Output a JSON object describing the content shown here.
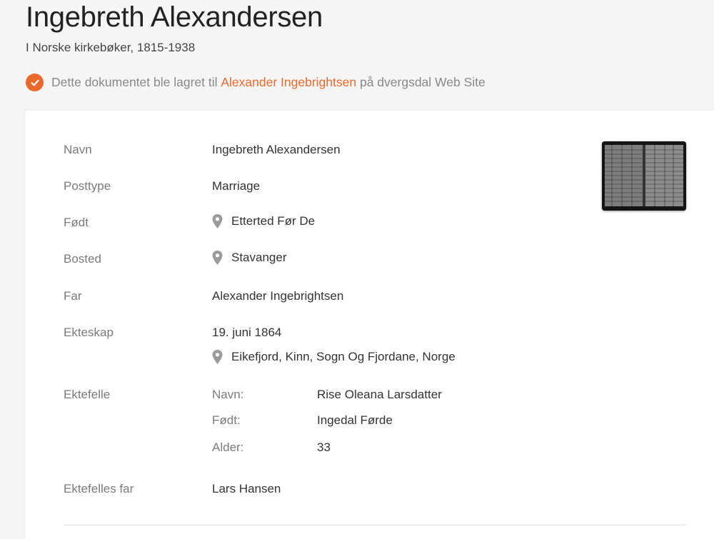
{
  "header": {
    "title": "Ingebreth Alexandersen",
    "collection": "I Norske kirkebøker, 1815-1938"
  },
  "notice": {
    "prefix": "Dette dokumentet ble lagret til",
    "person_link": "Alexander Ingebrightsen",
    "suffix": "på dvergsdal Web Site",
    "icon": "check-circle-icon",
    "accent_color": "#e9692c"
  },
  "record": {
    "navn": {
      "label": "Navn",
      "value": "Ingebreth Alexandersen"
    },
    "posttype": {
      "label": "Posttype",
      "value": "Marriage"
    },
    "fodt": {
      "label": "Født",
      "value": "Etterted Før De",
      "icon": "location-pin-icon"
    },
    "bosted": {
      "label": "Bosted",
      "value": "Stavanger",
      "icon": "location-pin-icon"
    },
    "far": {
      "label": "Far",
      "value": "Alexander Ingebrightsen"
    },
    "ekteskap": {
      "label": "Ekteskap",
      "date": "19. juni 1864",
      "place": "Eikefjord, Kinn, Sogn Og Fjordane, Norge",
      "icon": "location-pin-icon"
    },
    "ektefelle": {
      "label": "Ektefelle",
      "navn_label": "Navn:",
      "navn_value": "Rise Oleana Larsdatter",
      "fodt_label": "Født:",
      "fodt_value": "Ingedal Førde",
      "alder_label": "Alder:",
      "alder_value": "33"
    },
    "ektefelles_far": {
      "label": "Ektefelles far",
      "value": "Lars Hansen"
    }
  },
  "thumbnail": {
    "icon": "record-image-thumbnail"
  }
}
